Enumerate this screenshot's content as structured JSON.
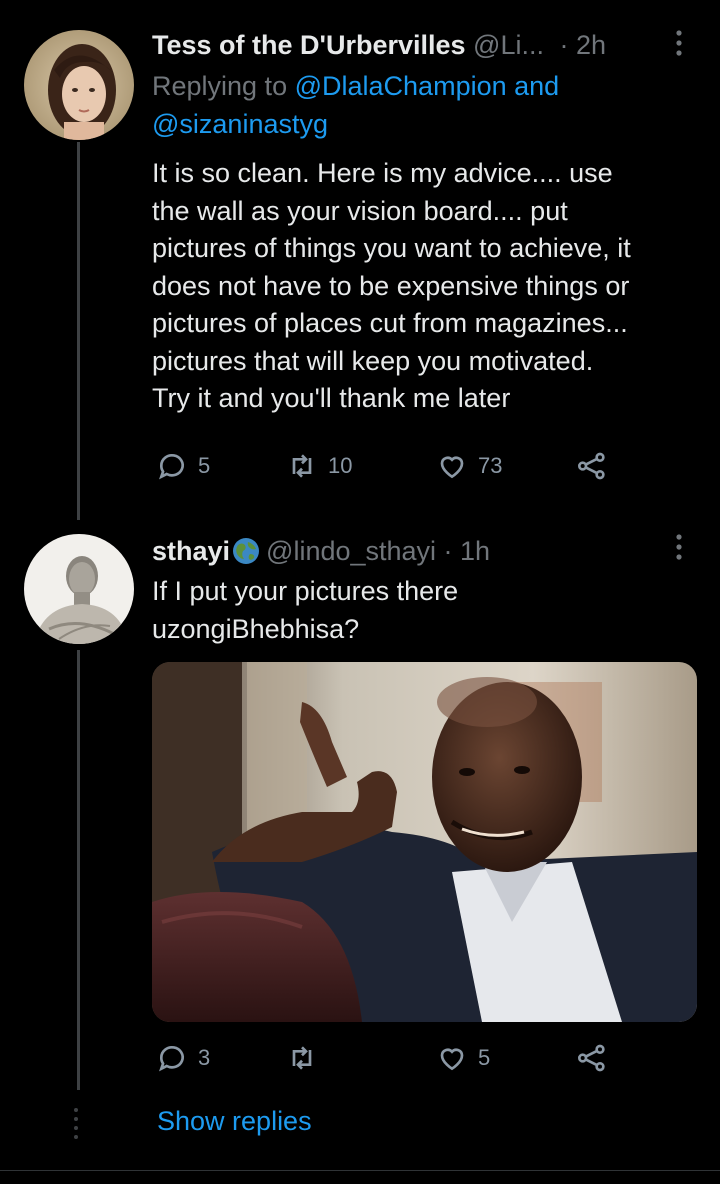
{
  "tweet1": {
    "name": "Tess of the D'Urbervilles",
    "handle": "@Li...",
    "time": "· 2h",
    "replying_prefix": "Replying to",
    "replying_user1": "@DlalaChampion",
    "replying_and": "and",
    "replying_user2": "@sizaninastyg",
    "lines": [
      "It is so clean. Here is my advice.... use",
      "the wall as your vision board.... put",
      "pictures of things you want to achieve, it",
      "does not have to be expensive things or",
      "pictures of places cut from magazines...",
      "pictures that will keep you motivated.",
      "Try it and you'll thank me later"
    ],
    "reply_count": "5",
    "retweet_count": "10",
    "like_count": "73"
  },
  "tweet2": {
    "name": "sthayi",
    "handle": "@lindo_sthayi · 1h",
    "lines": [
      "If I put your pictures there",
      "uzongiBhebhisa?"
    ],
    "reply_count": "3",
    "retweet_count": "",
    "like_count": "5"
  },
  "show_replies": "Show replies",
  "icons": [
    "more-icon",
    "reply-icon",
    "retweet-icon",
    "like-icon",
    "share-icon",
    "globe-emoji-icon"
  ],
  "colors": {
    "background": "#000000",
    "accent": "#1d9bf0",
    "muted": "#71767b",
    "text": "#e7e9ea"
  }
}
